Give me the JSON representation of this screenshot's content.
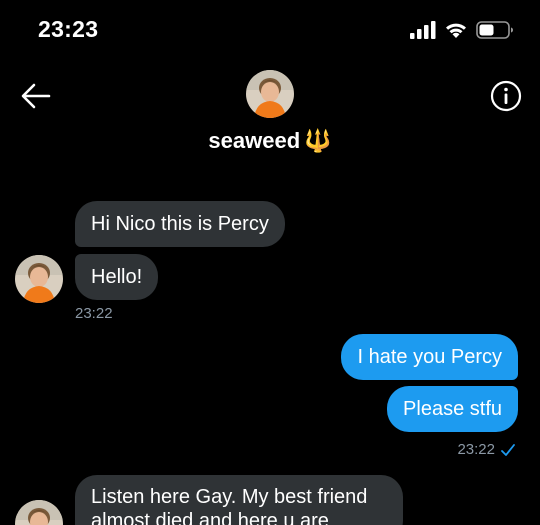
{
  "status_bar": {
    "time": "23:23",
    "icons": [
      "signal-icon",
      "wifi-icon",
      "battery-icon"
    ]
  },
  "header": {
    "name": "seaweed",
    "name_emoji": "🔱",
    "back_icon": "arrow-left-icon",
    "info_icon": "info-icon"
  },
  "messages": [
    {
      "direction": "in",
      "text": "Hi Nico this is Percy"
    },
    {
      "direction": "in",
      "text": "Hello!"
    },
    {
      "direction": "in_time",
      "text": "23:22"
    },
    {
      "direction": "out",
      "text": "I hate you Percy"
    },
    {
      "direction": "out",
      "text": "Please stfu"
    },
    {
      "direction": "out_time",
      "text": "23:22",
      "read": true
    },
    {
      "direction": "in",
      "text": "Listen here Gay. My best friend almost died and here u are"
    }
  ],
  "colors": {
    "background": "#000000",
    "incoming_bubble": "#2f3336",
    "outgoing_bubble": "#1d9bf0",
    "timestamp": "#8b98a5",
    "accent": "#1d9bf0"
  }
}
